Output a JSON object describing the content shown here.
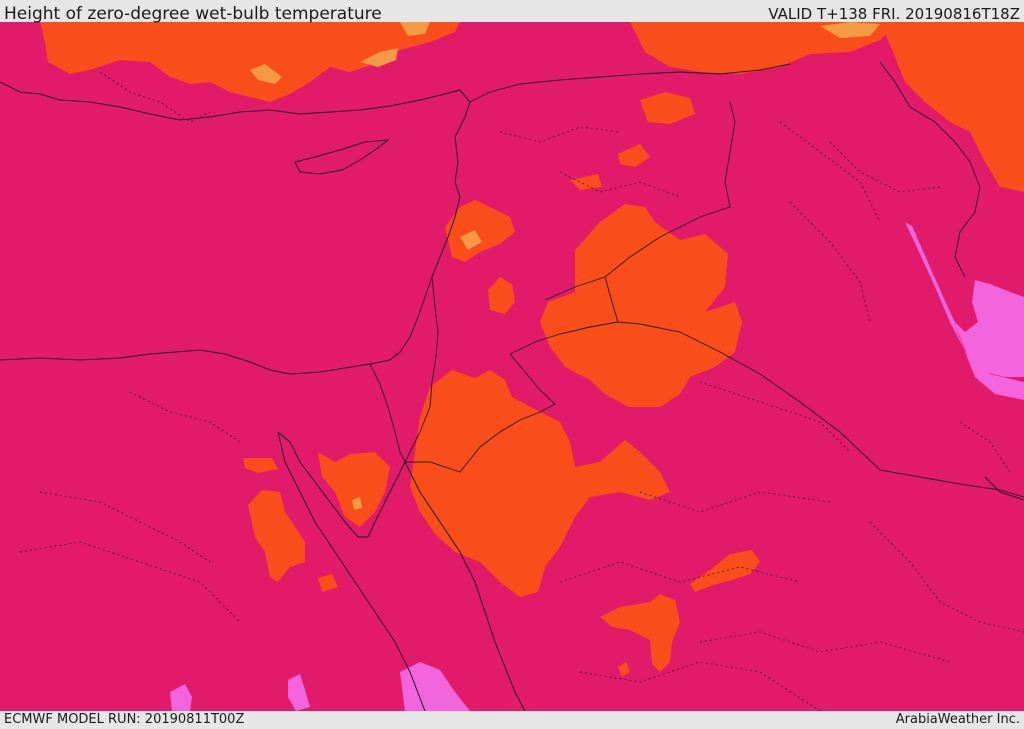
{
  "header": {
    "title": "Height of zero-degree wet-bulb temperature",
    "valid": "VALID T+138 FRI. 20190816T18Z"
  },
  "footer": {
    "model_run": "ECMWF MODEL RUN: 20190811T00Z",
    "credit": "ArabiaWeather Inc."
  },
  "colors": {
    "base_magenta": "#e21a6a",
    "orange": "#f94d1a",
    "light_orange": "#f59a44",
    "pink": "#f265dd",
    "border_line": "#1e1e1e",
    "frame_bar": "#e6e6e6"
  }
}
